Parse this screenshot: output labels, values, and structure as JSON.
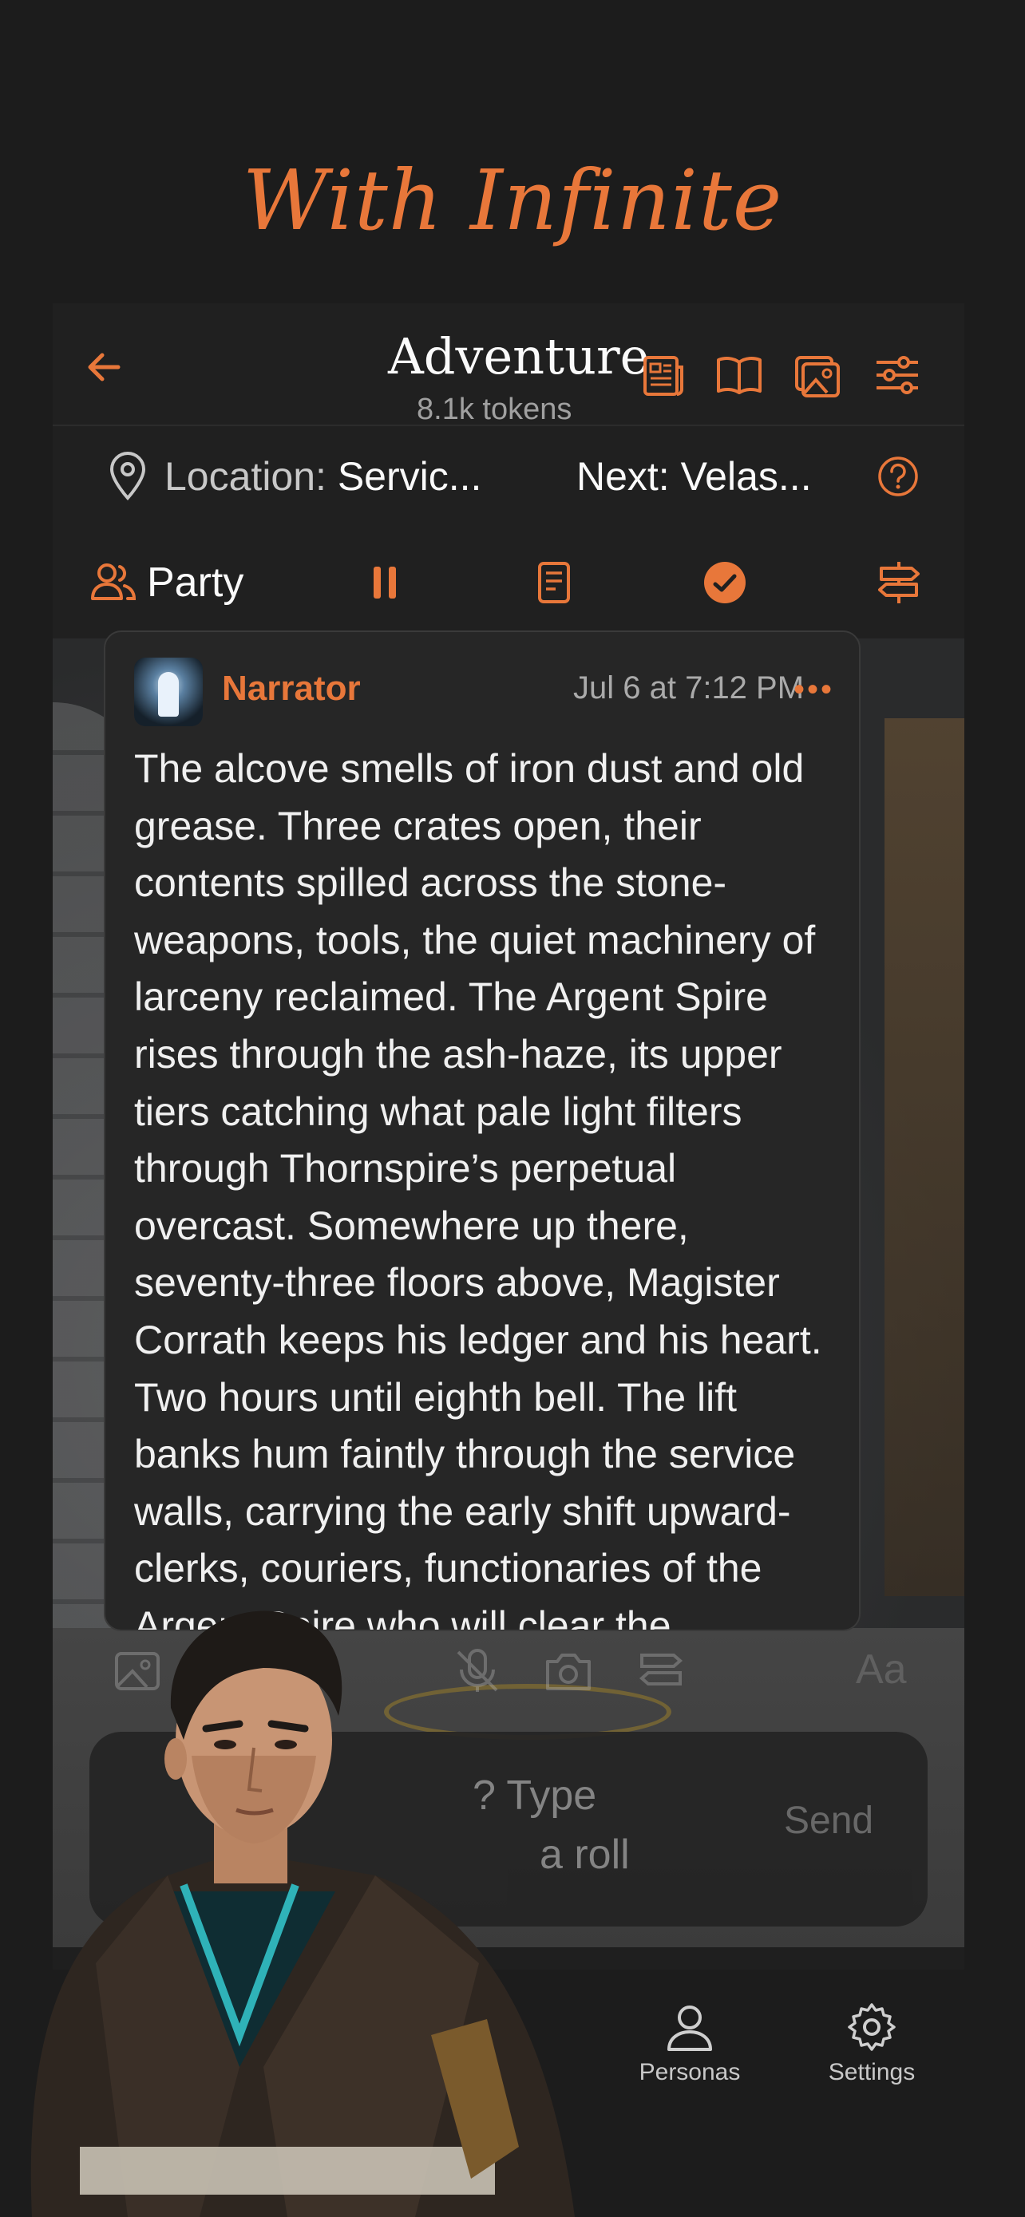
{
  "promo": {
    "title": "With Infinite"
  },
  "header": {
    "title": "Adventure",
    "subtitle": "8.1k tokens",
    "icons": [
      "back-arrow-icon",
      "newspaper-icon",
      "book-icon",
      "image-gallery-icon",
      "sliders-icon"
    ]
  },
  "location": {
    "label": "Location: ",
    "value": "Servic...",
    "next": "Next: Velas..."
  },
  "toolbar": {
    "party_label": "Party"
  },
  "message": {
    "author": "Narrator",
    "time": "Jul 6 at 7:12 PM",
    "more": "•••",
    "body": "The alcove smells of iron dust and old grease. Three crates open, their contents spilled across the stone-weapons, tools, the quiet machinery of larceny reclaimed. The Argent Spire rises through the ash-haze, its upper tiers catching what pale light filters through Thornspire’s perpetual overcast. Somewhere up there, seventy-three floors above, Magister Corrath keeps his ledger and his heart. Two hours until eighth bell. The lift banks hum faintly through the service walls, carrying the early shift upward-clerks, couriers, functionaries of the Argent Spire who will clear the"
  },
  "composer": {
    "aa_label": "Aa",
    "placeholder_line1": "? Type",
    "placeholder_line2": "a roll",
    "send_label": "Send"
  },
  "nav": {
    "personas": "Personas",
    "settings": "Settings"
  },
  "colors": {
    "accent": "#e8773a",
    "background": "#1c1c1c",
    "panel": "#202020",
    "card": "#262626"
  }
}
